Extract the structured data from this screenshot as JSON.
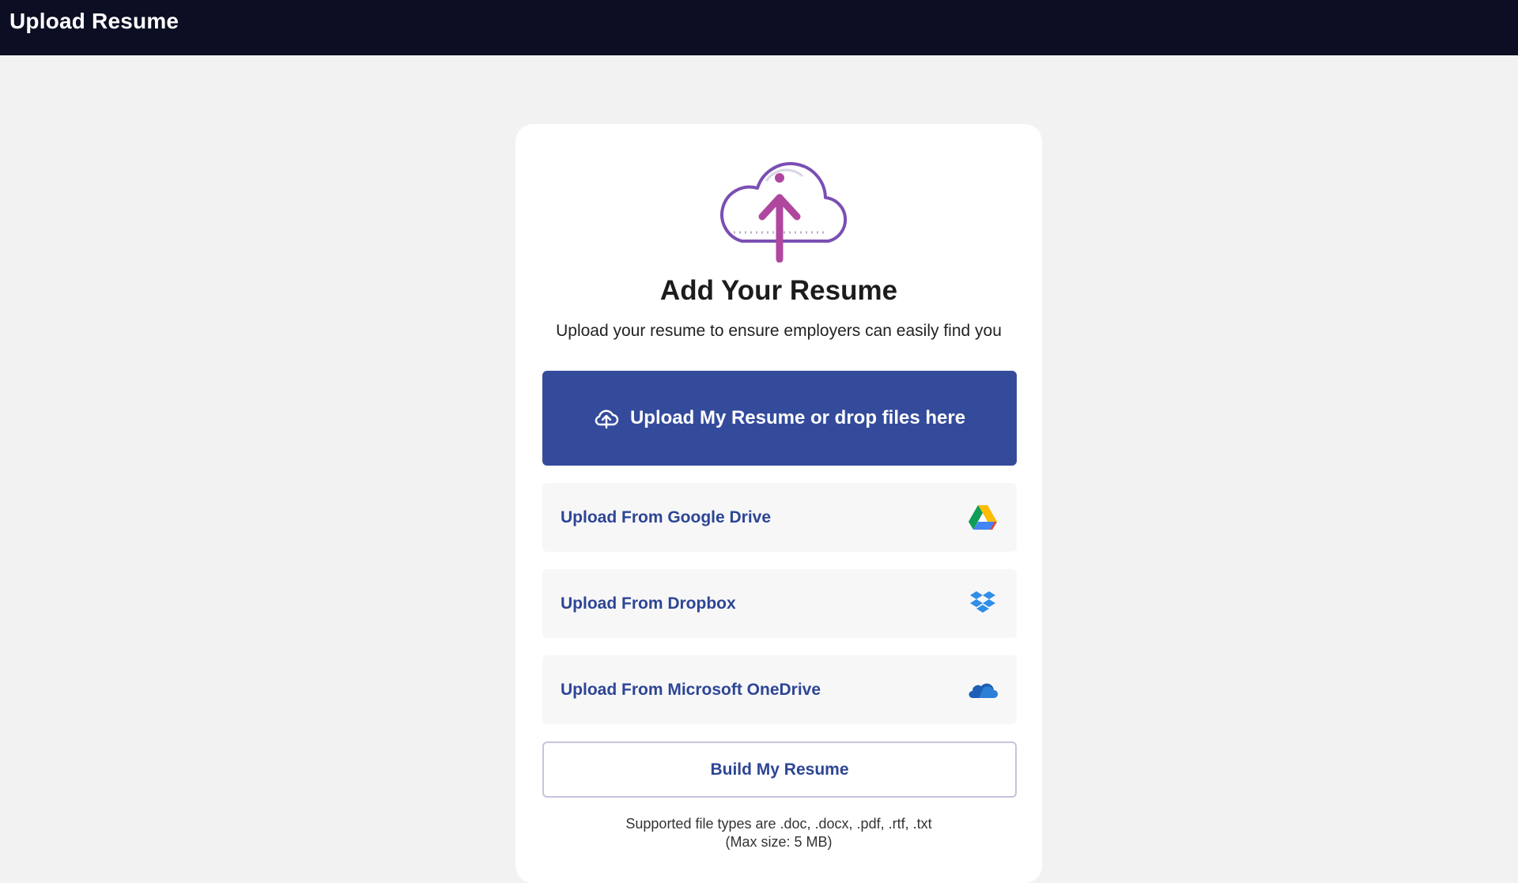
{
  "header": {
    "title": "Upload Resume",
    "background_color": "#0c0f23"
  },
  "card": {
    "heading": "Add Your Resume",
    "subheading": "Upload your resume to ensure employers can easily find you",
    "hero_icon": "cloud-upload-icon"
  },
  "primary_upload": {
    "label": "Upload My Resume or drop files here",
    "icon": "cloud-upload-icon",
    "color": "#344b9c"
  },
  "sources": [
    {
      "label": "Upload From Google Drive",
      "icon": "google-drive-icon"
    },
    {
      "label": "Upload From Dropbox",
      "icon": "dropbox-icon"
    },
    {
      "label": "Upload From Microsoft OneDrive",
      "icon": "onedrive-icon"
    }
  ],
  "build_button": {
    "label": "Build My Resume"
  },
  "footer_note": {
    "file_types": "Supported file types are .doc, .docx, .pdf, .rtf, .txt",
    "max_size": "(Max size: 5 MB)"
  },
  "colors": {
    "link_text": "#2d4594",
    "page_background": "#f2f2f2",
    "accent_purple": "#7b4fb3",
    "accent_magenta": "#b0479f"
  }
}
